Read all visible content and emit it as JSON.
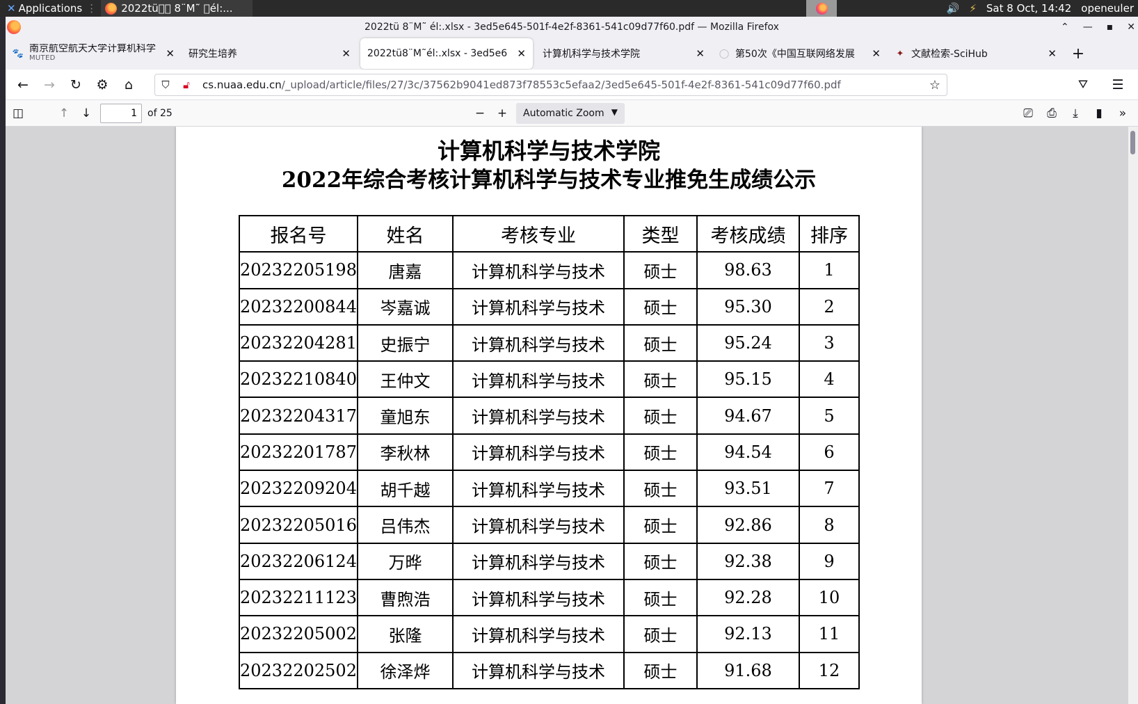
{
  "system_panel": {
    "applications_label": "Applications",
    "task_label": "2022tü\u0000\u0000 8¨M˜ \u0000él:...",
    "date_time": "Sat  8 Oct, 14:42",
    "user": "openeuler"
  },
  "window": {
    "title": "2022tü   8¨M˜ él:.xlsx - 3ed5e645-501f-4e2f-8361-541c09d77f60.pdf — Mozilla Firefox"
  },
  "tabs": [
    {
      "label": "南京航空航天大学计算机科学",
      "sub": "MUTED",
      "active": false
    },
    {
      "label": "研究生培养",
      "active": false
    },
    {
      "label": "2022tü8¨M˜él:.xlsx - 3ed5e6",
      "active": true
    },
    {
      "label": "计算机科学与技术学院",
      "active": false
    },
    {
      "label": "第50次《中国互联网络发展",
      "active": false
    },
    {
      "label": "文献检索-SciHub",
      "active": false
    }
  ],
  "url": {
    "host": "cs.nuaa.edu.cn",
    "path": "/_upload/article/files/27/3c/37562b9041ed873f78553c5efaa2/3ed5e645-501f-4e2f-8361-541c09d77f60.pdf"
  },
  "pdf_toolbar": {
    "page_number": "1",
    "page_count": "of 25",
    "zoom": "Automatic Zoom"
  },
  "document": {
    "title": "计算机科学与技术学院",
    "subtitle": "2022年综合考核计算机科学与技术专业推免生成绩公示",
    "headers": [
      "报名号",
      "姓名",
      "考核专业",
      "类型",
      "考核成绩",
      "排序"
    ],
    "rows": [
      [
        "20232205198",
        "唐嘉",
        "计算机科学与技术",
        "硕士",
        "98.63",
        "1"
      ],
      [
        "20232200844",
        "岑嘉诚",
        "计算机科学与技术",
        "硕士",
        "95.30",
        "2"
      ],
      [
        "20232204281",
        "史振宁",
        "计算机科学与技术",
        "硕士",
        "95.24",
        "3"
      ],
      [
        "20232210840",
        "王仲文",
        "计算机科学与技术",
        "硕士",
        "95.15",
        "4"
      ],
      [
        "20232204317",
        "童旭东",
        "计算机科学与技术",
        "硕士",
        "94.67",
        "5"
      ],
      [
        "20232201787",
        "李秋林",
        "计算机科学与技术",
        "硕士",
        "94.54",
        "6"
      ],
      [
        "20232209204",
        "胡千越",
        "计算机科学与技术",
        "硕士",
        "93.51",
        "7"
      ],
      [
        "20232205016",
        "吕伟杰",
        "计算机科学与技术",
        "硕士",
        "92.86",
        "8"
      ],
      [
        "20232206124",
        "万晔",
        "计算机科学与技术",
        "硕士",
        "92.38",
        "9"
      ],
      [
        "20232211123",
        "曹煦浩",
        "计算机科学与技术",
        "硕士",
        "92.28",
        "10"
      ],
      [
        "20232205002",
        "张隆",
        "计算机科学与技术",
        "硕士",
        "92.13",
        "11"
      ],
      [
        "20232202502",
        "徐泽烨",
        "计算机科学与技术",
        "硕士",
        "91.68",
        "12"
      ]
    ]
  }
}
